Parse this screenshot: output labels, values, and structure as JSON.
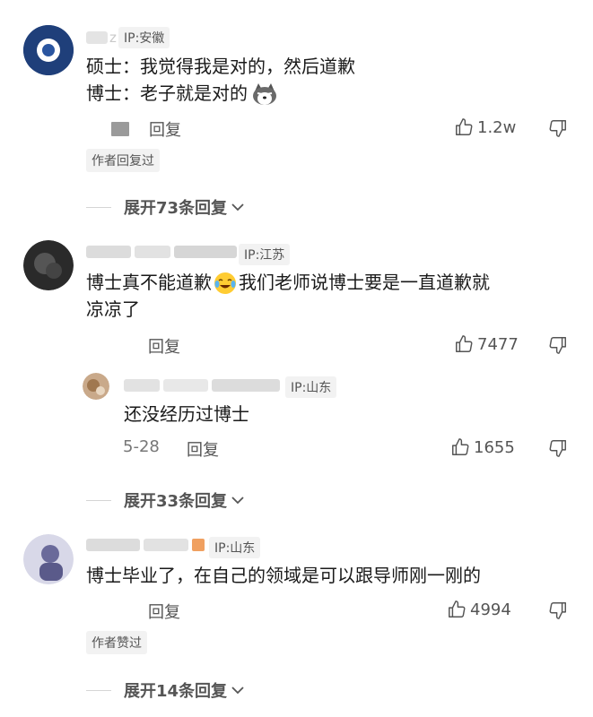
{
  "comments": [
    {
      "username": "z",
      "ip": "IP:安徽",
      "lines": [
        "硕士：我觉得我是对的，然后道歉",
        "博士：老子就是对的"
      ],
      "reply_label": "回复",
      "likes": "1.2w",
      "badge": "作者回复过",
      "expand": "展开73条回复"
    },
    {
      "ip": "IP:江苏",
      "lines": [
        "博士真不能道歉",
        "我们老师说博士要是一直道歉就",
        "凉凉了"
      ],
      "reply_label": "回复",
      "likes": "7477",
      "reply": {
        "ip": "IP:山东",
        "content": "还没经历过博士",
        "date": "5-28",
        "reply_label": "回复",
        "likes": "1655"
      },
      "expand": "展开33条回复"
    },
    {
      "ip": "IP:山东",
      "lines": [
        "博士毕业了，在自己的领域是可以跟导师刚一刚的"
      ],
      "reply_label": "回复",
      "likes": "4994",
      "badge": "作者赞过",
      "expand": "展开14条回复"
    }
  ],
  "colors": {
    "avatar1": "#1f3f7a",
    "avatar2": "#2a2a2a",
    "avatar3": "#6a6a9a"
  }
}
